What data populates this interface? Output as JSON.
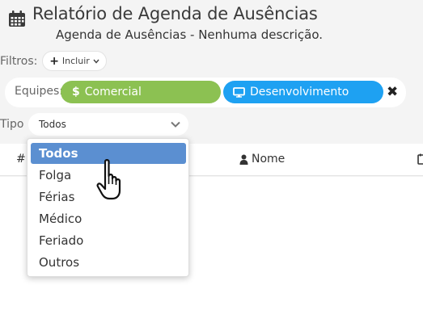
{
  "header": {
    "title": "Relatório de Agenda de Ausências",
    "subtitle": "Agenda de Ausências - Nenhuma descrição."
  },
  "filters": {
    "label": "Filtros:",
    "add_button_label": "Incluir"
  },
  "equipes": {
    "label": "Equipes:",
    "chips": [
      {
        "label": "Comercial",
        "icon": "dollar-icon",
        "color": "#8cc152"
      },
      {
        "label": "Desenvolvimento",
        "icon": "monitor-icon",
        "color": "#1ea1f2"
      }
    ]
  },
  "tipo": {
    "label": "Tipo",
    "selected": "Todos",
    "options": [
      "Todos",
      "Folga",
      "Férias",
      "Médico",
      "Feriado",
      "Outros"
    ],
    "highlight_color": "#5b8fd1"
  },
  "table": {
    "columns": [
      "#",
      "Nome"
    ]
  }
}
